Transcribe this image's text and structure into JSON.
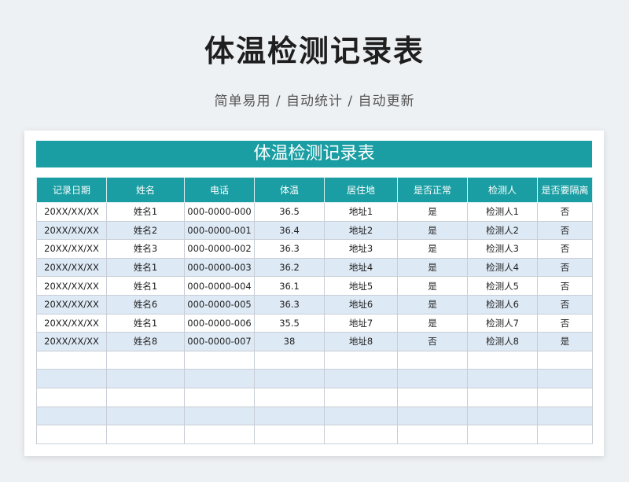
{
  "page": {
    "title": "体温检测记录表",
    "subtitle": "简单易用 / 自动统计 / 自动更新"
  },
  "sheet": {
    "banner": "体温检测记录表",
    "headers": [
      "记录日期",
      "姓名",
      "电话",
      "体温",
      "居住地",
      "是否正常",
      "检测人",
      "是否要隔离"
    ],
    "rows": [
      [
        "20XX/XX/XX",
        "姓名1",
        "000-0000-000",
        "36.5",
        "地址1",
        "是",
        "检测人1",
        "否"
      ],
      [
        "20XX/XX/XX",
        "姓名2",
        "000-0000-001",
        "36.4",
        "地址2",
        "是",
        "检测人2",
        "否"
      ],
      [
        "20XX/XX/XX",
        "姓名3",
        "000-0000-002",
        "36.3",
        "地址3",
        "是",
        "检测人3",
        "否"
      ],
      [
        "20XX/XX/XX",
        "姓名1",
        "000-0000-003",
        "36.2",
        "地址4",
        "是",
        "检测人4",
        "否"
      ],
      [
        "20XX/XX/XX",
        "姓名1",
        "000-0000-004",
        "36.1",
        "地址5",
        "是",
        "检测人5",
        "否"
      ],
      [
        "20XX/XX/XX",
        "姓名6",
        "000-0000-005",
        "36.3",
        "地址6",
        "是",
        "检测人6",
        "否"
      ],
      [
        "20XX/XX/XX",
        "姓名1",
        "000-0000-006",
        "35.5",
        "地址7",
        "是",
        "检测人7",
        "否"
      ],
      [
        "20XX/XX/XX",
        "姓名8",
        "000-0000-007",
        "38",
        "地址8",
        "否",
        "检测人8",
        "是"
      ],
      [
        "",
        "",
        "",
        "",
        "",
        "",
        "",
        ""
      ],
      [
        "",
        "",
        "",
        "",
        "",
        "",
        "",
        ""
      ],
      [
        "",
        "",
        "",
        "",
        "",
        "",
        "",
        ""
      ],
      [
        "",
        "",
        "",
        "",
        "",
        "",
        "",
        ""
      ],
      [
        "",
        "",
        "",
        "",
        "",
        "",
        "",
        ""
      ]
    ]
  },
  "colors": {
    "accent": "#1a9ea3",
    "row_alt": "#dde9f5",
    "background": "#eef1f4"
  }
}
